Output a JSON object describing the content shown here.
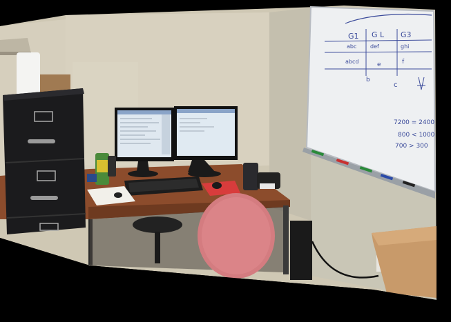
{
  "scene": {
    "type": "photo-panorama",
    "colors": {
      "background": "#000000",
      "wall": "#d4cfc0",
      "desk": "#8a4a2a",
      "cabinet": "#1c1c1e",
      "whiteboard": "#eef0f2",
      "chair": "#d88080",
      "mousepad": "#d83c3c"
    }
  },
  "whiteboard": {
    "headers": [
      "G1",
      "G L",
      "G3"
    ],
    "row1": [
      "abc",
      "def",
      "ghi"
    ],
    "row2": [
      "abcd",
      "e",
      "f"
    ],
    "row3": [
      "b",
      "c"
    ],
    "equations": [
      "7200 = 2400",
      "800 < 1000",
      "700 > 300"
    ]
  }
}
